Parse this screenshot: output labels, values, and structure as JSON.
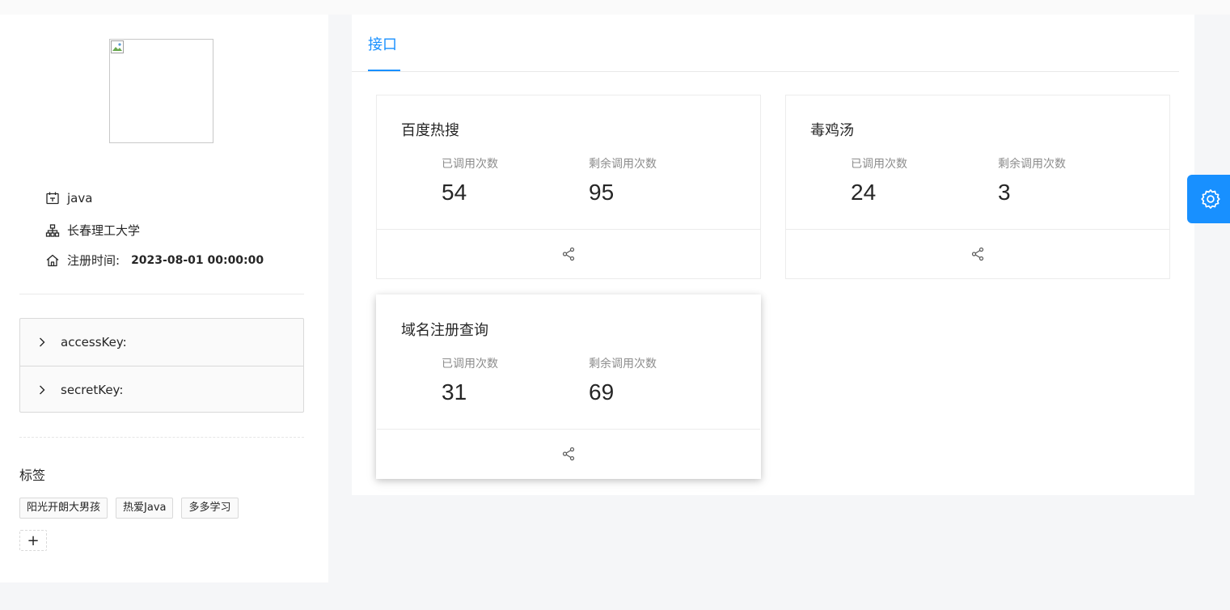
{
  "profile": {
    "username": "java",
    "school": "长春理工大学",
    "register_label": "注册时间:",
    "register_time": "2023-08-01 00:00:00",
    "icons": [
      "calendar-icon",
      "cluster-icon",
      "home-icon"
    ]
  },
  "keys": [
    {
      "label": "accessKey:"
    },
    {
      "label": "secretKey:"
    }
  ],
  "tags": {
    "title": "标签",
    "items": [
      "阳光开朗大男孩",
      "热爱Java",
      "多多学习"
    ],
    "add_label": "+"
  },
  "main": {
    "tabs": [
      {
        "label": "接口",
        "active": true
      }
    ],
    "stat_labels": {
      "used": "已调用次数",
      "remaining": "剩余调用次数"
    },
    "cards": [
      {
        "title": "百度热搜",
        "used": "54",
        "remaining": "95"
      },
      {
        "title": "毒鸡汤",
        "used": "24",
        "remaining": "3"
      },
      {
        "title": "域名注册查询",
        "used": "31",
        "remaining": "69"
      }
    ]
  },
  "colors": {
    "accent": "#1890ff",
    "text": "#262626",
    "muted": "#8c8c8c"
  }
}
